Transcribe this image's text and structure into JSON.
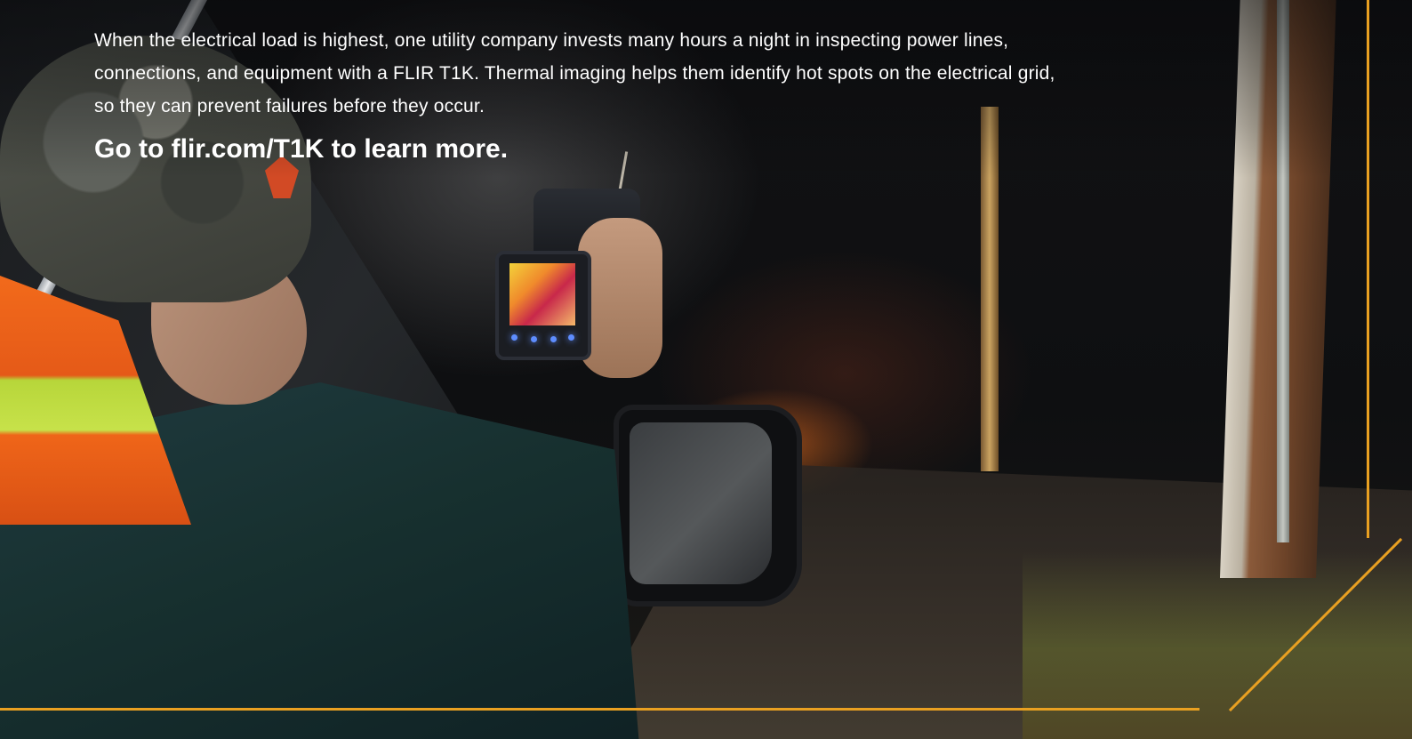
{
  "ad": {
    "body_lines": [
      "When the electrical load is highest, one utility company invests many hours a night in inspecting power lines,",
      "connections, and equipment with a FLIR T1K. Thermal imaging helps them identify hot spots on the electrical grid,",
      "so they can prevent failures before they occur."
    ],
    "cta": "Go to flir.com/T1K to learn more."
  },
  "colors": {
    "accent_frame": "#e9a021",
    "text": "#ffffff"
  }
}
